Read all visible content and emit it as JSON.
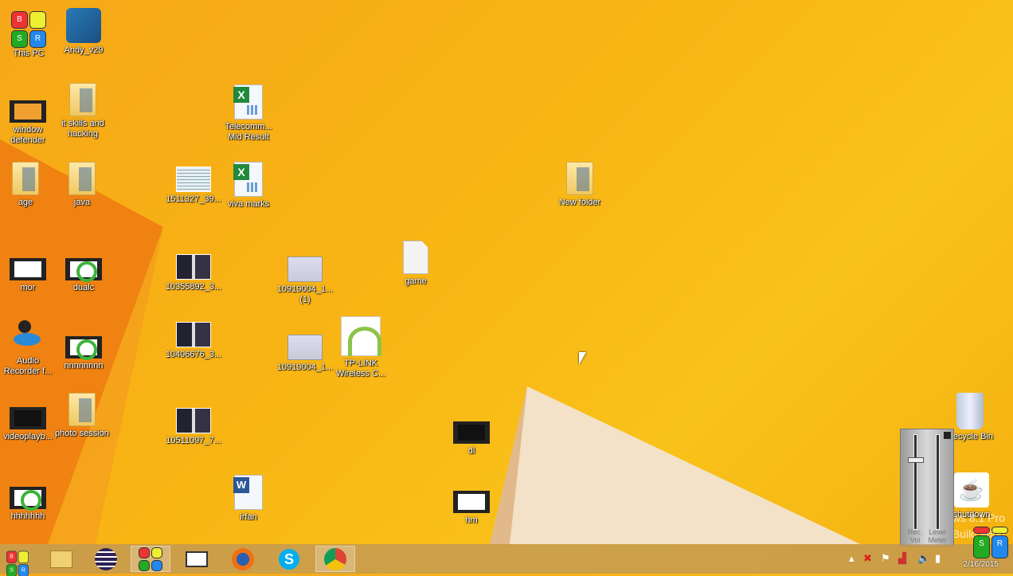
{
  "desktop": {
    "icons": [
      {
        "label": "This PC",
        "type": "bsr"
      },
      {
        "label": "Andy_v29",
        "type": "app"
      },
      {
        "label": "window defender",
        "type": "video orange"
      },
      {
        "label": "it skills and hacking",
        "type": "folder"
      },
      {
        "label": "Telecomm... Mid Result",
        "type": "excel"
      },
      {
        "label": "age",
        "type": "folder"
      },
      {
        "label": "java",
        "type": "folder"
      },
      {
        "label": "1511327_39...",
        "type": "photo doc"
      },
      {
        "label": "viva marks",
        "type": "excel"
      },
      {
        "label": "New folder",
        "type": "folder"
      },
      {
        "label": "mor",
        "type": "video"
      },
      {
        "label": "dualc",
        "type": "video green"
      },
      {
        "label": "10355892_3...",
        "type": "photo"
      },
      {
        "label": "10919004_1... (1)",
        "type": "photo shot"
      },
      {
        "label": "game",
        "type": "file"
      },
      {
        "label": "Audio Recorder f...",
        "type": "mic"
      },
      {
        "label": "nnnnnnnn",
        "type": "video green"
      },
      {
        "label": "10406676_3...",
        "type": "photo"
      },
      {
        "label": "10919004_1...",
        "type": "photo shot"
      },
      {
        "label": "TP-LINK Wireless C...",
        "type": "wifi"
      },
      {
        "label": "videoplayb...",
        "type": "video black"
      },
      {
        "label": "photo session",
        "type": "folder"
      },
      {
        "label": "10511097_7...",
        "type": "photo"
      },
      {
        "label": "dl",
        "type": "video black"
      },
      {
        "label": "hhhhhhh",
        "type": "video green"
      },
      {
        "label": "irfan",
        "type": "word"
      },
      {
        "label": "hm",
        "type": "video"
      },
      {
        "label": "Recycle Bin",
        "type": "bin"
      },
      {
        "label": "shutdown",
        "type": "java"
      }
    ],
    "bsr_letters": [
      "B",
      "",
      "S",
      "R"
    ],
    "watermark": [
      "Windows 8.1 Pro",
      "Build 9600"
    ]
  },
  "mixer": {
    "rec_vol_label": "Rec. Vol",
    "level_meter_label": "Level Meter",
    "rec_vol": 0.75,
    "level": 0
  },
  "taskbar": {
    "items": [
      "Start",
      "File Explorer",
      "Eclipse",
      "BSR Screen Recorder",
      "Reader",
      "Firefox",
      "Skype",
      "Chrome"
    ],
    "clock": "2/16/2015"
  },
  "colors": {
    "wallpaper": "#f8b414",
    "taskbar": "#be965a"
  }
}
